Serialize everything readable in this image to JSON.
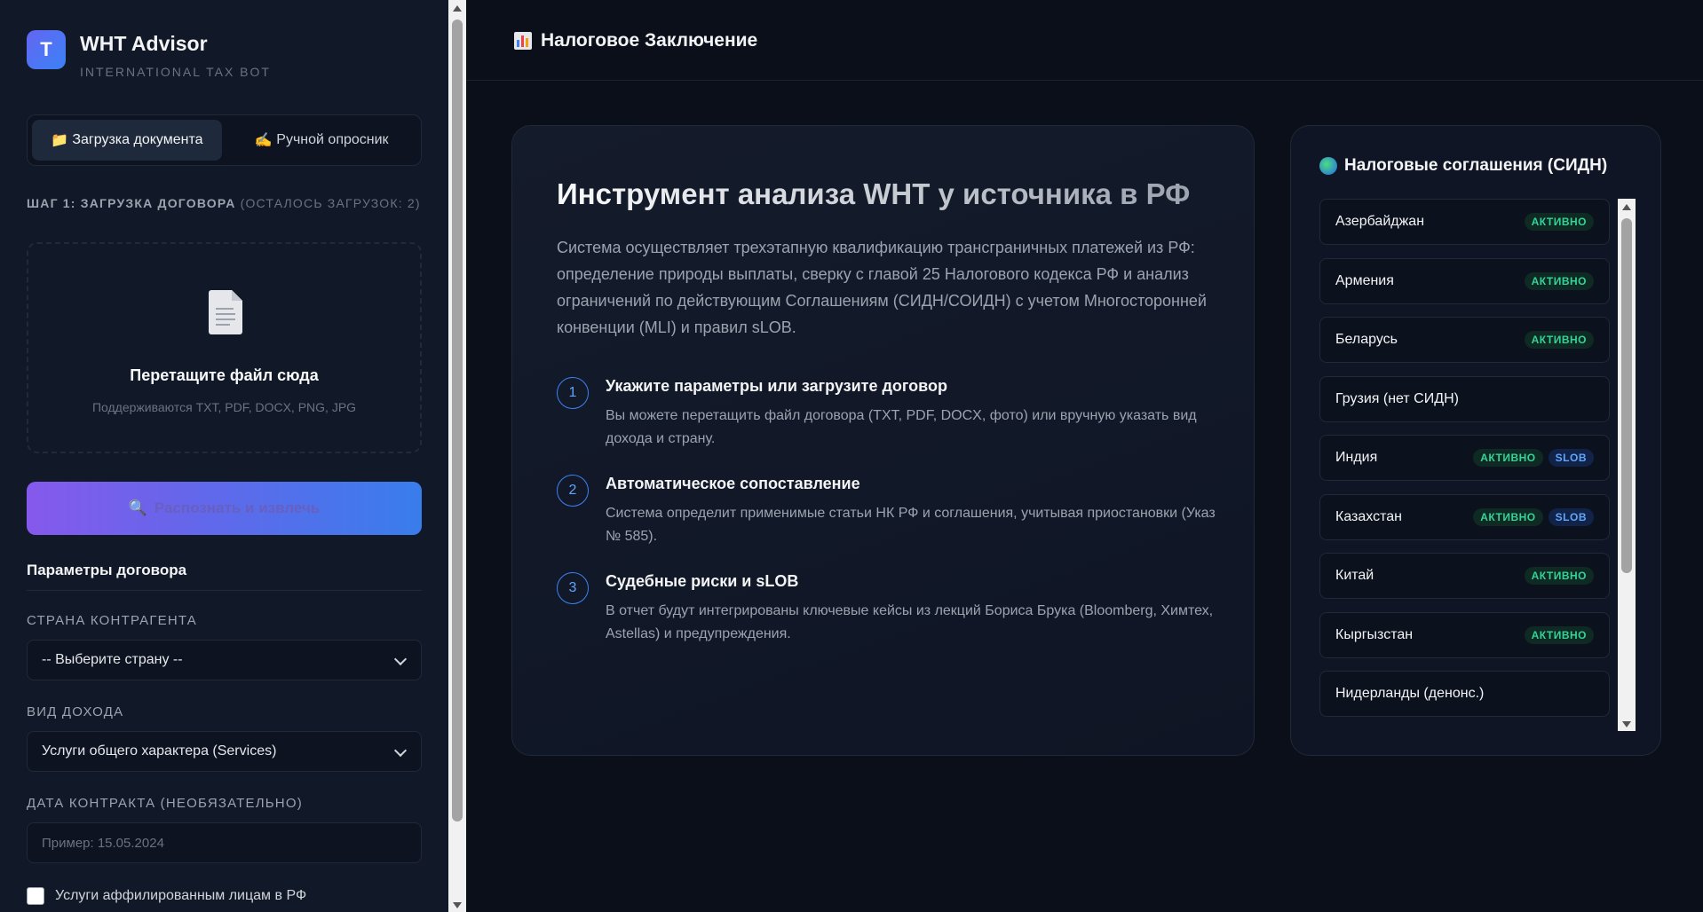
{
  "brand": {
    "logo": "T",
    "title": "WHT Advisor",
    "subtitle": "INTERNATIONAL TAX BOT"
  },
  "sidebar": {
    "tabs": [
      {
        "icon": "📁",
        "label": "Загрузка документа"
      },
      {
        "icon": "✍️",
        "label": "Ручной опросник"
      }
    ],
    "step_label": "ШАГ 1: ЗАГРУЗКА ДОГОВОРА",
    "step_remaining": "(ОСТАЛОСЬ ЗАГРУЗОК: 2)",
    "dropzone": {
      "title": "Перетащите файл сюда",
      "hint": "Поддерживаются TXT, PDF, DOCX, PNG, JPG"
    },
    "extract_button": "Распознать и извлечь",
    "params_title": "Параметры договора",
    "country_label": "СТРАНА КОНТРАГЕНТА",
    "country_value": "-- Выберите страну --",
    "income_label": "ВИД ДОХОДА",
    "income_value": "Услуги общего характера (Services)",
    "date_label": "ДАТА КОНТРАКТА (НЕОБЯЗАТЕЛЬНО)",
    "date_placeholder": "Пример: 15.05.2024",
    "affiliated_label": "Услуги аффилированным лицам в РФ"
  },
  "header": {
    "title": "Налоговое Заключение"
  },
  "hero": {
    "title": "Инструмент анализа WHT у источника в РФ",
    "description": "Система осуществляет трехэтапную квалификацию трансграничных платежей из РФ: определение природы выплаты, сверку с главой 25 Налогового кодекса РФ и анализ ограничений по действующим Соглашениям (СИДН/СОИДН) с учетом Многосторонней конвенции (MLI) и правил sLOB.",
    "steps": [
      {
        "num": "1",
        "title": "Укажите параметры или загрузите договор",
        "text": "Вы можете перетащить файл договора (TXT, PDF, DOCX, фото) или вручную указать вид дохода и страну."
      },
      {
        "num": "2",
        "title": "Автоматическое сопоставление",
        "text": "Система определит применимые статьи НК РФ и соглашения, учитывая приостановки (Указ № 585)."
      },
      {
        "num": "3",
        "title": "Судебные риски и sLOB",
        "text": "В отчет будут интегрированы ключевые кейсы из лекций Бориса Брука (Bloomberg, Химтех, Astellas) и предупреждения."
      }
    ]
  },
  "treaties": {
    "title": "Налоговые соглашения (СИДН)",
    "items": [
      {
        "name": "Азербайджан",
        "badges": [
          "АКТИВНО"
        ]
      },
      {
        "name": "Армения",
        "badges": [
          "АКТИВНО"
        ]
      },
      {
        "name": "Беларусь",
        "badges": [
          "АКТИВНО"
        ]
      },
      {
        "name": "Грузия (нет СИДН)",
        "badges": []
      },
      {
        "name": "Индия",
        "badges": [
          "АКТИВНО",
          "SLOB"
        ]
      },
      {
        "name": "Казахстан",
        "badges": [
          "АКТИВНО",
          "SLOB"
        ]
      },
      {
        "name": "Китай",
        "badges": [
          "АКТИВНО"
        ]
      },
      {
        "name": "Кыргызстан",
        "badges": [
          "АКТИВНО"
        ]
      },
      {
        "name": "Нидерланды (денонс.)",
        "badges": []
      }
    ]
  },
  "colors": {
    "accent": "#3b82f6",
    "accent2": "#8b5cf6",
    "active": "#34d399",
    "background": "#0b0f1a"
  }
}
